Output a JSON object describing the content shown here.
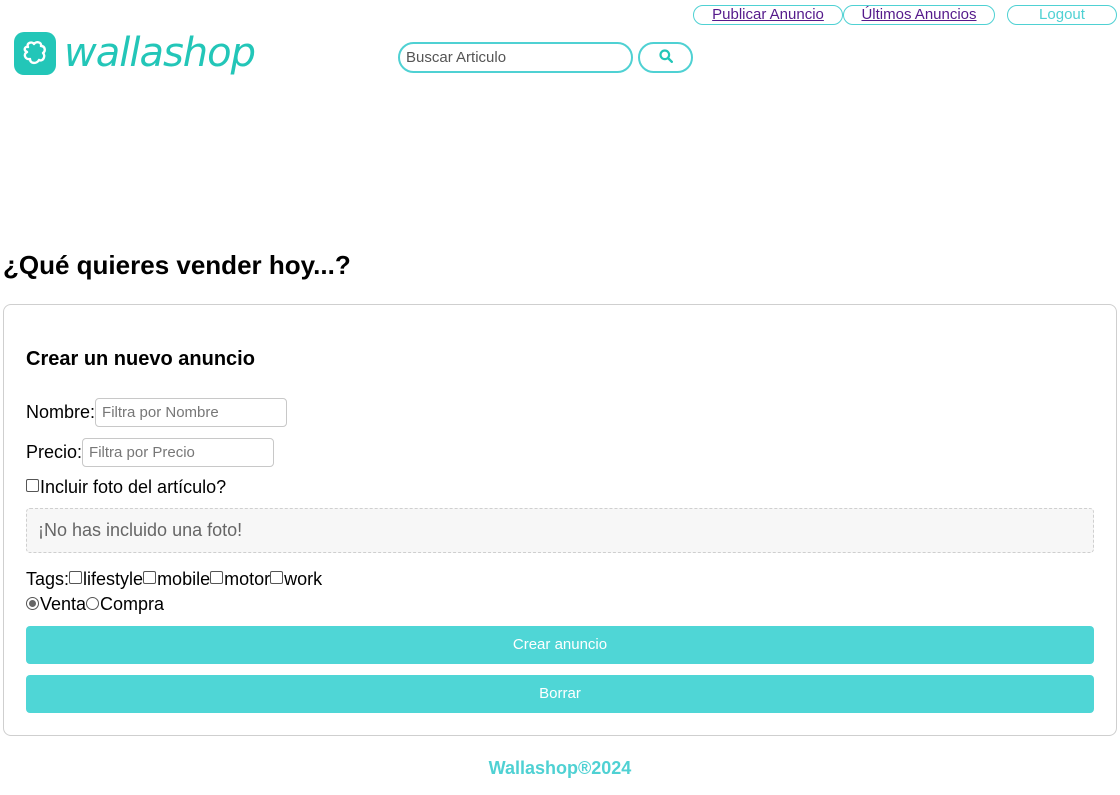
{
  "nav": {
    "publicar": "Publicar Anuncio",
    "ultimos": "Últimos Anuncios",
    "logout": "Logout"
  },
  "logo": {
    "text": "wallashop",
    "icon": "shopping-bag-icon"
  },
  "search": {
    "placeholder": "Buscar Articulo",
    "value": "",
    "icon": "search-icon"
  },
  "page": {
    "title": "¿Qué quieres vender hoy...?"
  },
  "form": {
    "title": "Crear un nuevo anuncio",
    "nombre_label": "Nombre:",
    "nombre_placeholder": "Filtra por Nombre",
    "precio_label": "Precio:",
    "precio_placeholder": "Filtra por Precio",
    "foto_label": "Incluir foto del artículo?",
    "foto_checked": false,
    "no_photo_text": "¡No has incluido una foto!",
    "tags_label": "Tags:",
    "tags": [
      {
        "label": "lifestyle",
        "checked": false
      },
      {
        "label": "mobile",
        "checked": false
      },
      {
        "label": "motor",
        "checked": false
      },
      {
        "label": "work",
        "checked": false
      }
    ],
    "types": [
      {
        "label": "Venta",
        "checked": true
      },
      {
        "label": "Compra",
        "checked": false
      }
    ],
    "submit_label": "Crear anuncio",
    "reset_label": "Borrar"
  },
  "footer": {
    "text": "Wallashop®2024"
  },
  "colors": {
    "accent": "#4fd1d3",
    "brand": "#23c6b8"
  }
}
